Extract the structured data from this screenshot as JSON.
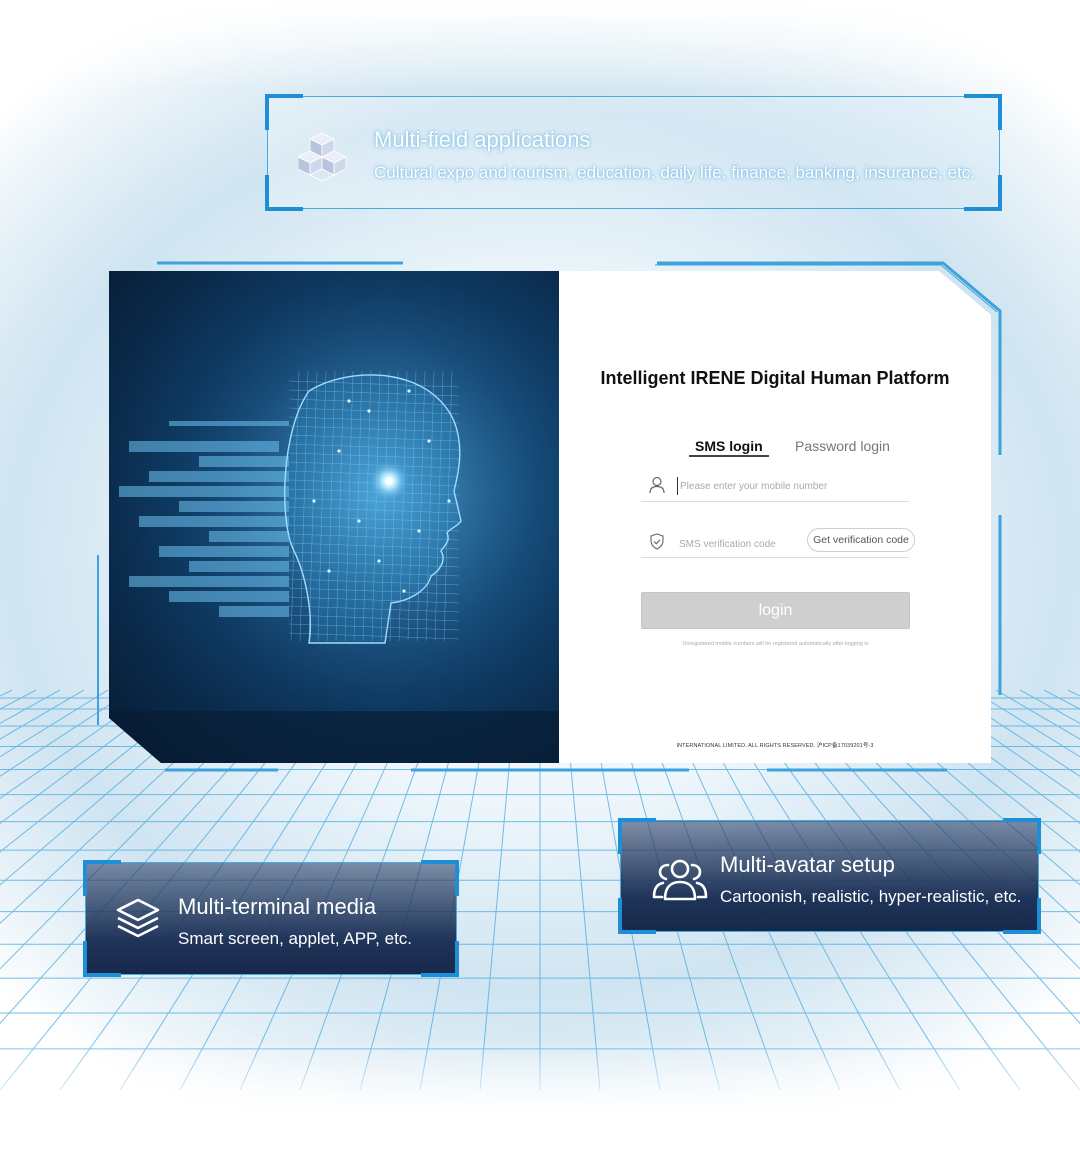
{
  "features": {
    "applications": {
      "title": "Multi-field applications",
      "description": "Cultural expo and tourism, education, daily life, finance, banking, insurance, etc.",
      "icon": "cubes-icon"
    },
    "terminal": {
      "title": "Multi-terminal media",
      "description": "Smart screen, applet, APP, etc.",
      "icon": "layers-icon"
    },
    "avatar": {
      "title": "Multi-avatar setup",
      "description": "Cartoonish, realistic, hyper-realistic, etc.",
      "icon": "users-icon"
    }
  },
  "login": {
    "platform_title": "Intelligent IRENE Digital Human Platform",
    "tabs": [
      {
        "label": "SMS login",
        "active": true
      },
      {
        "label": "Password login",
        "active": false
      }
    ],
    "phone_placeholder": "Please enter your mobile number",
    "code_placeholder": "SMS verification code",
    "get_code_label": "Get verification code",
    "login_label": "login",
    "hint": "Unregistered mobile numbers will be registered automatically after logging in",
    "footer": "INTERNATIONAL LIMITED. ALL RIGHTS RESERVED. 沪ICP备17039201号-3"
  },
  "colors": {
    "accent": "#1e8fd6",
    "card_dark": "#1f3459",
    "login_disabled": "#cfcfcf"
  }
}
